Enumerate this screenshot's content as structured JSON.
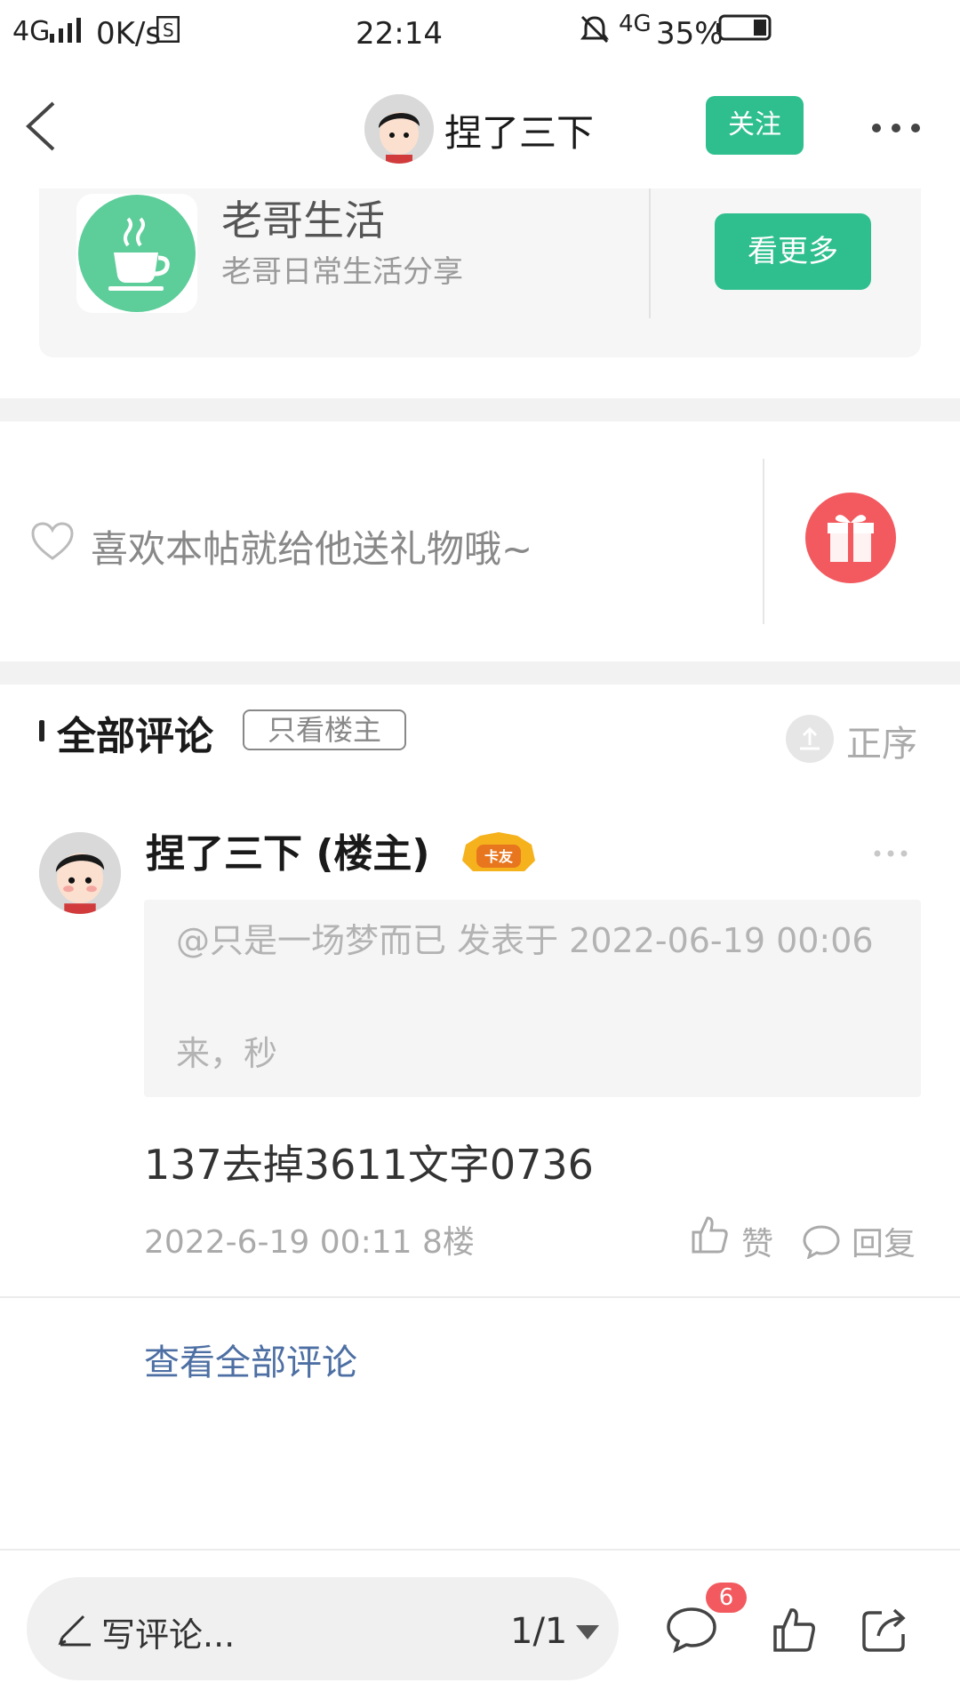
{
  "status_bar": {
    "network_left": "4G",
    "speed": "0K/s",
    "time": "22:14",
    "network_right": "4G",
    "battery": "35%"
  },
  "header": {
    "title": "捏了三下",
    "follow_label": "关注"
  },
  "circle_card": {
    "title": "老哥生活",
    "subtitle": "老哥日常生活分享",
    "see_more_label": "看更多"
  },
  "gift_prompt": {
    "text": "喜欢本帖就给他送礼物哦~"
  },
  "comments_section": {
    "title": "全部评论",
    "only_op_label": "只看楼主",
    "sort_label": "正序",
    "comment": {
      "author": "捏了三下 (楼主)",
      "badge": "卡友",
      "quote_header": "@只是一场梦而已 发表于 2022-06-19 00:06",
      "quote_text": "来，秒",
      "body": "137去掉3611文字0736",
      "meta": "2022-6-19 00:11  8楼",
      "like_label": "赞",
      "reply_label": "回复"
    },
    "view_all_label": "查看全部评论"
  },
  "bottom_bar": {
    "compose_placeholder": "写评论...",
    "page_indicator": "1/1",
    "comment_count": "6"
  },
  "colors": {
    "accent_green": "#2fbf8f",
    "gift_red": "#f25a5f",
    "link_blue": "#4d6fa3"
  }
}
